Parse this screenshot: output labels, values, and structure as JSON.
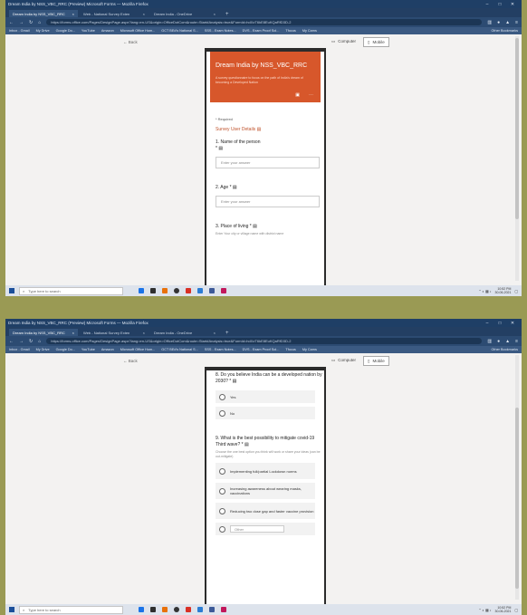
{
  "colors": {
    "outer_bg": "#9a9a54",
    "banner": "#d7572b",
    "section": "#c0532c",
    "browser_title": "#1f3f66"
  },
  "screens": [
    {
      "window_title": "Dream India by NSS_VBC_RRC (Preview) Microsoft Forms — Mozilla Firefox",
      "tabs": [
        {
          "label": "Dream India by NSS_VBC_RRC",
          "close": "×"
        },
        {
          "label": "Web - National Survey Exten",
          "close": "×"
        },
        {
          "label": "Dream India - OneDrive",
          "close": "×"
        }
      ],
      "new_tab": "+",
      "url": "https://forms.office.com/Pages/DesignPage.aspx?lang=en-US&origin=OfficeDotCom&route=Start#Analysis=true&FormId=hdXzT6kE8EuKQaRfD3D-2",
      "bookmarks": [
        "Inbox - Gmail",
        "My Drive",
        "Google Do...",
        "YouTube",
        "Amazon",
        "Microsoft Office Hom...",
        "GCT BEd's National S...",
        "SSS - Exam Notes...",
        "DVS - Exam Proof Sol...",
        "Tfocus",
        "My Cams"
      ],
      "other_bookmarks": "Other Bookmarks",
      "back_label": "Back",
      "view_computer": "Computer",
      "view_mobile": "Mobile",
      "form": {
        "title": "Dream India by NSS_VBC_RRC",
        "description": "A survey questionnaire to focus on the path of India's dream of becoming a Developed Nation",
        "required_note": "* Required",
        "section_title": "Survey User Details",
        "questions": [
          {
            "label": "1. Name of the person",
            "star": "*",
            "placeholder": "Enter your answer"
          },
          {
            "label": "2. Age *",
            "placeholder": "Enter your answer"
          },
          {
            "label": "3. Place of living *",
            "hint": "Enter Your city or village name with district name"
          }
        ]
      },
      "taskbar": {
        "search_placeholder": "Type here to search",
        "time": "10:52 PM",
        "date": "30-06-2021"
      }
    },
    {
      "window_title": "Dream India by NSS_VBC_RRC (Preview) Microsoft Forms — Mozilla Firefox",
      "tabs": [
        {
          "label": "Dream India by NSS_VBC_RRC",
          "close": "×"
        },
        {
          "label": "Web - National Survey Exten",
          "close": "×"
        },
        {
          "label": "Dream India - OneDrive",
          "close": "×"
        }
      ],
      "new_tab": "+",
      "url": "https://forms.office.com/Pages/DesignPage.aspx?lang=en-US&origin=OfficeDotCom&route=Start#Analysis=true&FormId=hdXzT6kE8EuKQaRfD3D-2",
      "bookmarks": [
        "Inbox - Gmail",
        "My Drive",
        "Google Do...",
        "YouTube",
        "Amazon",
        "Microsoft Office Hom...",
        "GCT BEd's National S...",
        "SSS - Exam Notes...",
        "DVS - Exam Proof Sol...",
        "Tfocus",
        "My Cams"
      ],
      "other_bookmarks": "Other Bookmarks",
      "back_label": "Back",
      "view_computer": "Computer",
      "view_mobile": "Mobile",
      "form": {
        "q8": "8. Do you believe India can be a developed nation by 2030? *",
        "q8_options": [
          "Yes",
          "No"
        ],
        "q9": "9. What is the best possibility to mitigate covid-19 Third wave? *",
        "q9_hint": "Choose the one best option you think will work or share your ideas (can be out-mitigate)",
        "q9_options": [
          "Implementing full/partial Lockdown norms",
          "Increasing awareness about wearing masks, vaccinations",
          "Reducing two dose gap and faster vaccine provision"
        ],
        "other_placeholder": "Other"
      },
      "taskbar": {
        "search_placeholder": "Type here to search",
        "time": "10:52 PM",
        "date": "30-06-2021"
      }
    }
  ]
}
